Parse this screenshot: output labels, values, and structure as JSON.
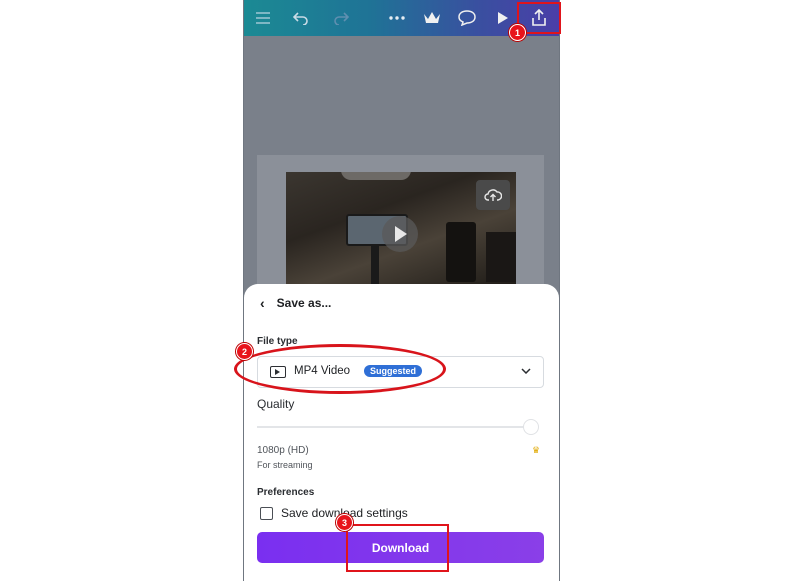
{
  "toolbar": {
    "icons": [
      "menu-icon",
      "undo-icon",
      "redo-icon",
      "more-icon",
      "crown-icon",
      "comment-icon",
      "play-icon",
      "share-icon"
    ]
  },
  "sheet": {
    "back_glyph": "‹",
    "title": "Save as...",
    "file_type_label": "File type",
    "file_type_value": "MP4 Video",
    "file_type_badge": "Suggested",
    "quality_label": "Quality",
    "quality_level": 1.0,
    "resolution": "1080p (HD)",
    "resolution_note": "For streaming",
    "preferences_label": "Preferences",
    "save_settings_label": "Save download settings",
    "save_settings_checked": false,
    "download_label": "Download"
  },
  "annotations": {
    "markers": [
      "1",
      "2",
      "3"
    ]
  },
  "colors": {
    "highlight": "#e0141b",
    "download_button": "#7a2ff0",
    "badge": "#2f6fd6"
  }
}
